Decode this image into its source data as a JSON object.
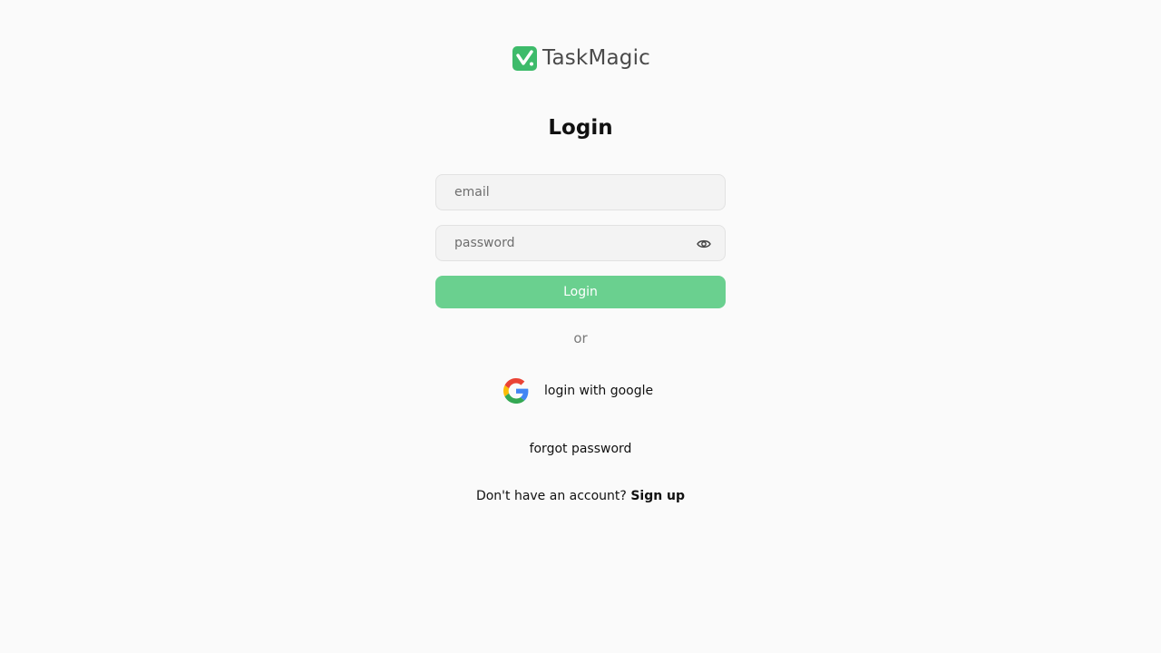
{
  "brand": {
    "name": "TaskMagic",
    "logo_icon": "checkmark-badge-icon",
    "accent_color": "#3dbb6a"
  },
  "form": {
    "title": "Login",
    "email": {
      "placeholder": "email",
      "value": ""
    },
    "password": {
      "placeholder": "password",
      "value": "",
      "toggle_icon": "eye-icon"
    },
    "submit_label": "Login",
    "submit_color": "#6ad08f"
  },
  "divider_text": "or",
  "google": {
    "label": "login with google",
    "icon": "google-icon"
  },
  "forgot_password_label": "forgot password",
  "signup": {
    "prompt": "Don't have an account?",
    "link_label": "Sign up"
  }
}
